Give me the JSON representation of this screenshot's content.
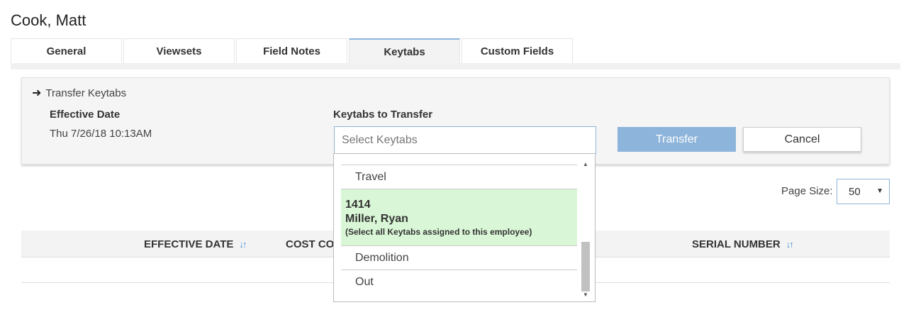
{
  "page": {
    "title": "Cook, Matt"
  },
  "tabs": [
    {
      "label": "General"
    },
    {
      "label": "Viewsets"
    },
    {
      "label": "Field Notes"
    },
    {
      "label": "Keytabs"
    },
    {
      "label": "Custom Fields"
    }
  ],
  "active_tab": "Keytabs",
  "transfer": {
    "heading": "Transfer Keytabs",
    "effective_date_label": "Effective Date",
    "effective_date_value": "Thu 7/26/18 10:13AM",
    "keytabs_label": "Keytabs to Transfer",
    "keytabs_placeholder": "Select Keytabs",
    "transfer_button": "Transfer",
    "cancel_button": "Cancel"
  },
  "dropdown": {
    "items": [
      {
        "label": "Travel"
      },
      {
        "id": "1414",
        "name": "Miller, Ryan",
        "note": "(Select all Keytabs assigned to this employee)"
      },
      {
        "label": "Demolition"
      },
      {
        "label": "Out"
      }
    ]
  },
  "page_size": {
    "label": "Page Size:",
    "value": "50"
  },
  "table": {
    "columns": [
      {
        "label": "EFFECTIVE DATE"
      },
      {
        "label": "COST CO"
      },
      {
        "label": "SERIAL NUMBER"
      }
    ]
  },
  "colors": {
    "accent": "#8db4da",
    "highlight": "#d9f7d6",
    "sort_icon": "#4a90d9"
  },
  "icons": {
    "heading_arrow": "arrow-right-icon",
    "sort": "sort-icon",
    "caret": "caret-down-icon"
  }
}
